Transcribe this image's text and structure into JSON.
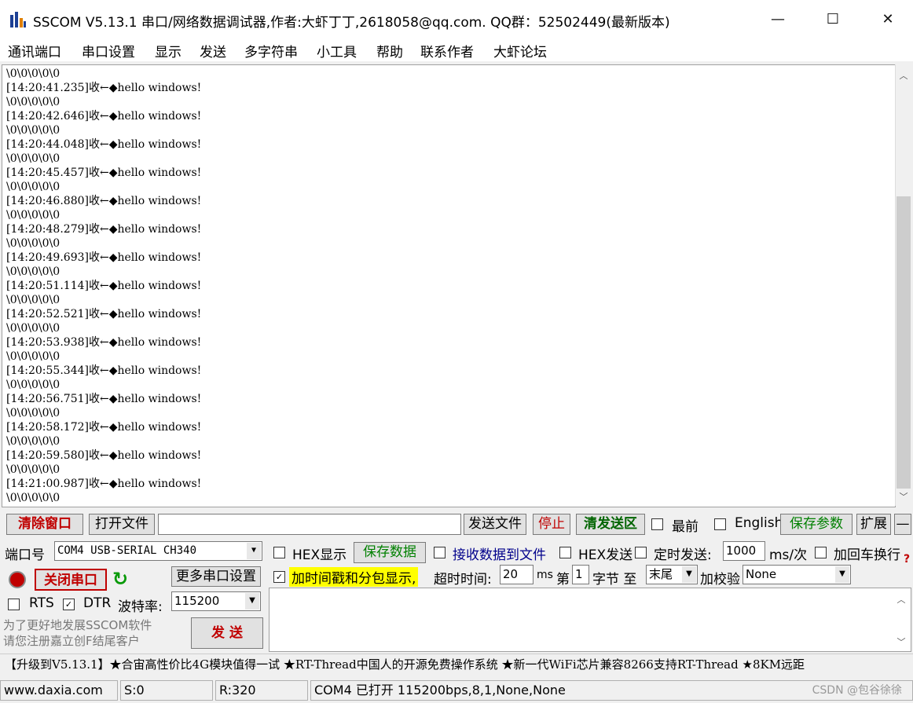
{
  "window": {
    "title": "SSCOM V5.13.1 串口/网络数据调试器,作者:大虾丁丁,2618058@qq.com. QQ群：52502449(最新版本)",
    "minimize": "—",
    "maximize": "☐",
    "close": "✕"
  },
  "menu": [
    "通讯端口",
    "串口设置",
    "显示",
    "发送",
    "多字符串",
    "小工具",
    "帮助",
    "联系作者",
    "大虾论坛"
  ],
  "receive": {
    "lines": [
      "\\0\\0\\0\\0\\0",
      "[14:20:41.235]收←◆hello windows!",
      "\\0\\0\\0\\0\\0",
      "[14:20:42.646]收←◆hello windows!",
      "\\0\\0\\0\\0\\0",
      "[14:20:44.048]收←◆hello windows!",
      "\\0\\0\\0\\0\\0",
      "[14:20:45.457]收←◆hello windows!",
      "\\0\\0\\0\\0\\0",
      "[14:20:46.880]收←◆hello windows!",
      "\\0\\0\\0\\0\\0",
      "[14:20:48.279]收←◆hello windows!",
      "\\0\\0\\0\\0\\0",
      "[14:20:49.693]收←◆hello windows!",
      "\\0\\0\\0\\0\\0",
      "[14:20:51.114]收←◆hello windows!",
      "\\0\\0\\0\\0\\0",
      "[14:20:52.521]收←◆hello windows!",
      "\\0\\0\\0\\0\\0",
      "[14:20:53.938]收←◆hello windows!",
      "\\0\\0\\0\\0\\0",
      "[14:20:55.344]收←◆hello windows!",
      "\\0\\0\\0\\0\\0",
      "[14:20:56.751]收←◆hello windows!",
      "\\0\\0\\0\\0\\0",
      "[14:20:58.172]收←◆hello windows!",
      "\\0\\0\\0\\0\\0",
      "[14:20:59.580]收←◆hello windows!",
      "\\0\\0\\0\\0\\0",
      "[14:21:00.987]收←◆hello windows!",
      "\\0\\0\\0\\0\\0"
    ]
  },
  "toolbar1": {
    "clear": "清除窗口",
    "open_file": "打开文件",
    "file_path": "",
    "send_file": "发送文件",
    "stop": "停止",
    "clear_send": "清发送区",
    "topmost": "最前",
    "english": "English",
    "save_params": "保存参数",
    "expand": "扩展",
    "collapse": "—"
  },
  "port": {
    "label": "端口号",
    "value": "COM4 USB-SERIAL CH340",
    "close_port": "关闭串口",
    "more_settings": "更多串口设置",
    "rts": "RTS",
    "dtr": "DTR",
    "baud_label": "波特率:",
    "baud": "115200"
  },
  "options": {
    "hex_display": "HEX显示",
    "save_data": "保存数据",
    "recv_to_file": "接收数据到文件",
    "hex_send": "HEX发送",
    "timed_send": "定时发送:",
    "interval": "1000",
    "interval_unit": "ms/次",
    "add_crlf": "加回车换行",
    "timestamp": "加时间戳和分包显示,",
    "timeout_label": "超时时间:",
    "timeout": "20",
    "timeout_unit": "ms",
    "nth_label": "第",
    "nth": "1",
    "byte_label": "字节 至",
    "end": "末尾",
    "checksum_label": "加校验",
    "checksum": "None"
  },
  "promo": "为了更好地发展SSCOM软件\n请您注册嘉立创F结尾客户",
  "send_button": "发 送",
  "ticker": "【升级到V5.13.1】★合宙高性价比4G模块值得一试 ★RT-Thread中国人的开源免费操作系统 ★新一代WiFi芯片兼容8266支持RT-Thread ★8KM远距",
  "status": {
    "site": "www.daxia.com",
    "sent": "S:0",
    "received": "R:320",
    "port_state": "COM4 已打开  115200bps,8,1,None,None"
  },
  "watermark": "CSDN @包谷徐徐"
}
